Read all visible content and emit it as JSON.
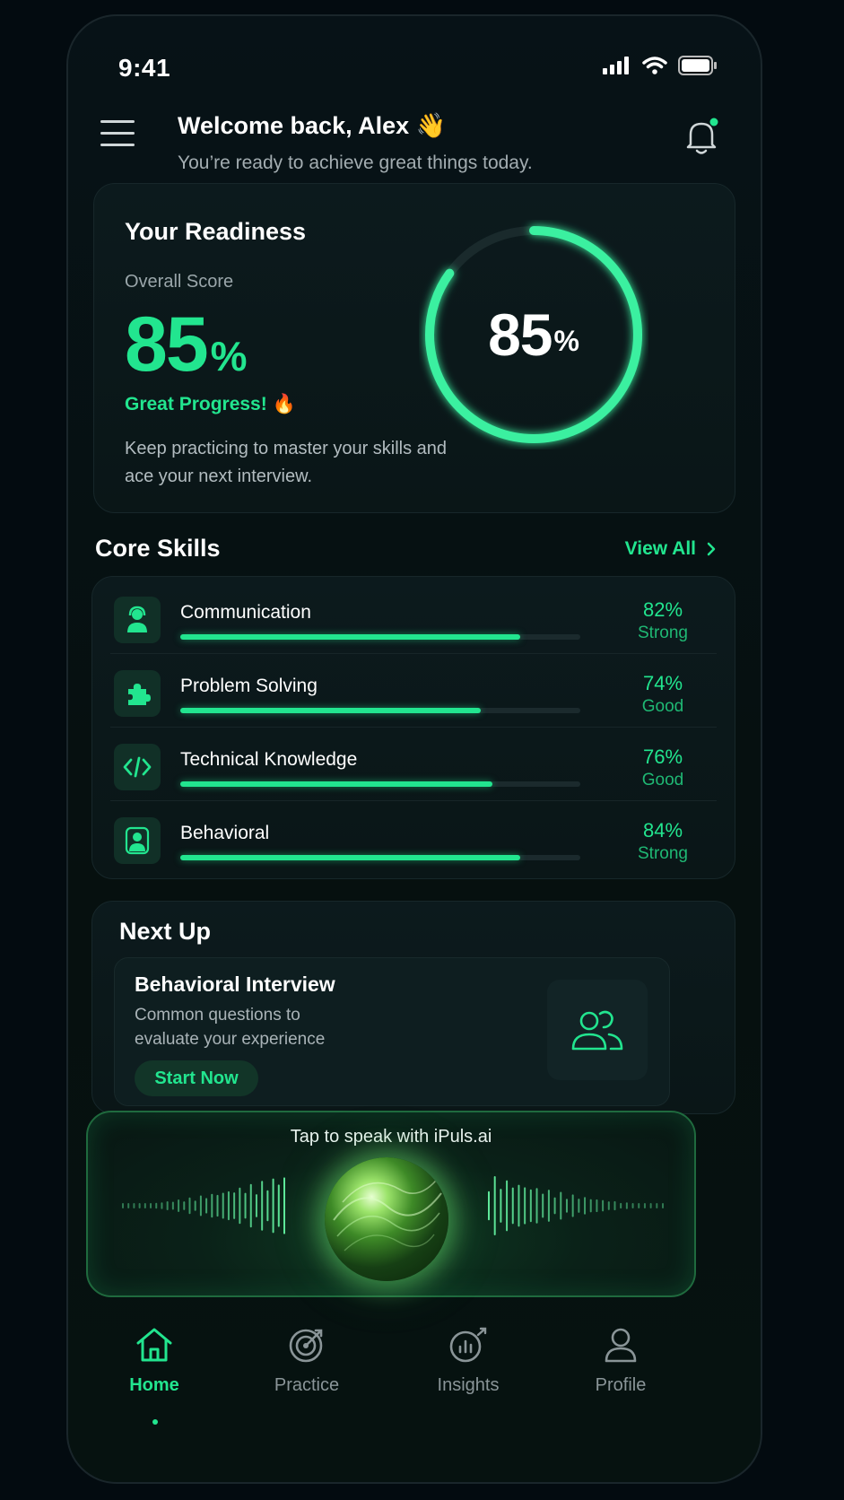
{
  "status": {
    "time": "9:41"
  },
  "header": {
    "welcome": "Welcome back, Alex 👋",
    "subtitle": "You’re ready to achieve great things today."
  },
  "readiness": {
    "title": "Your Readiness",
    "overall_label": "Overall Score",
    "score_value": "85",
    "score_unit": "%",
    "score_fraction": 0.85,
    "progress_text": "Great Progress! 🔥",
    "description": "Keep practicing to master your skills and ace your next interview."
  },
  "core_skills": {
    "title": "Core Skills",
    "view_all": "View All",
    "items": [
      {
        "name": "Communication",
        "value": "82%",
        "level": "Strong",
        "fraction": 0.85,
        "icon": "headset-person-icon"
      },
      {
        "name": "Problem Solving",
        "value": "74%",
        "level": "Good",
        "fraction": 0.75,
        "icon": "puzzle-icon"
      },
      {
        "name": "Technical Knowledge",
        "value": "76%",
        "level": "Good",
        "fraction": 0.78,
        "icon": "code-icon"
      },
      {
        "name": "Behavioral",
        "value": "84%",
        "level": "Strong",
        "fraction": 0.85,
        "icon": "person-badge-icon"
      }
    ]
  },
  "next_up": {
    "title": "Next Up",
    "heading": "Behavioral Interview",
    "description": "Common questions to evaluate your experience",
    "button": "Start Now",
    "icon": "people-icon"
  },
  "voice": {
    "label": "Tap to speak with iPuls.ai"
  },
  "tabs": [
    {
      "label": "Home",
      "icon": "home-icon",
      "active": true
    },
    {
      "label": "Practice",
      "icon": "target-icon",
      "active": false
    },
    {
      "label": "Insights",
      "icon": "insights-icon",
      "active": false
    },
    {
      "label": "Profile",
      "icon": "user-icon",
      "active": false
    }
  ],
  "colors": {
    "accent": "#22e58f",
    "background": "#030b10",
    "card": "#0c1a1d"
  }
}
